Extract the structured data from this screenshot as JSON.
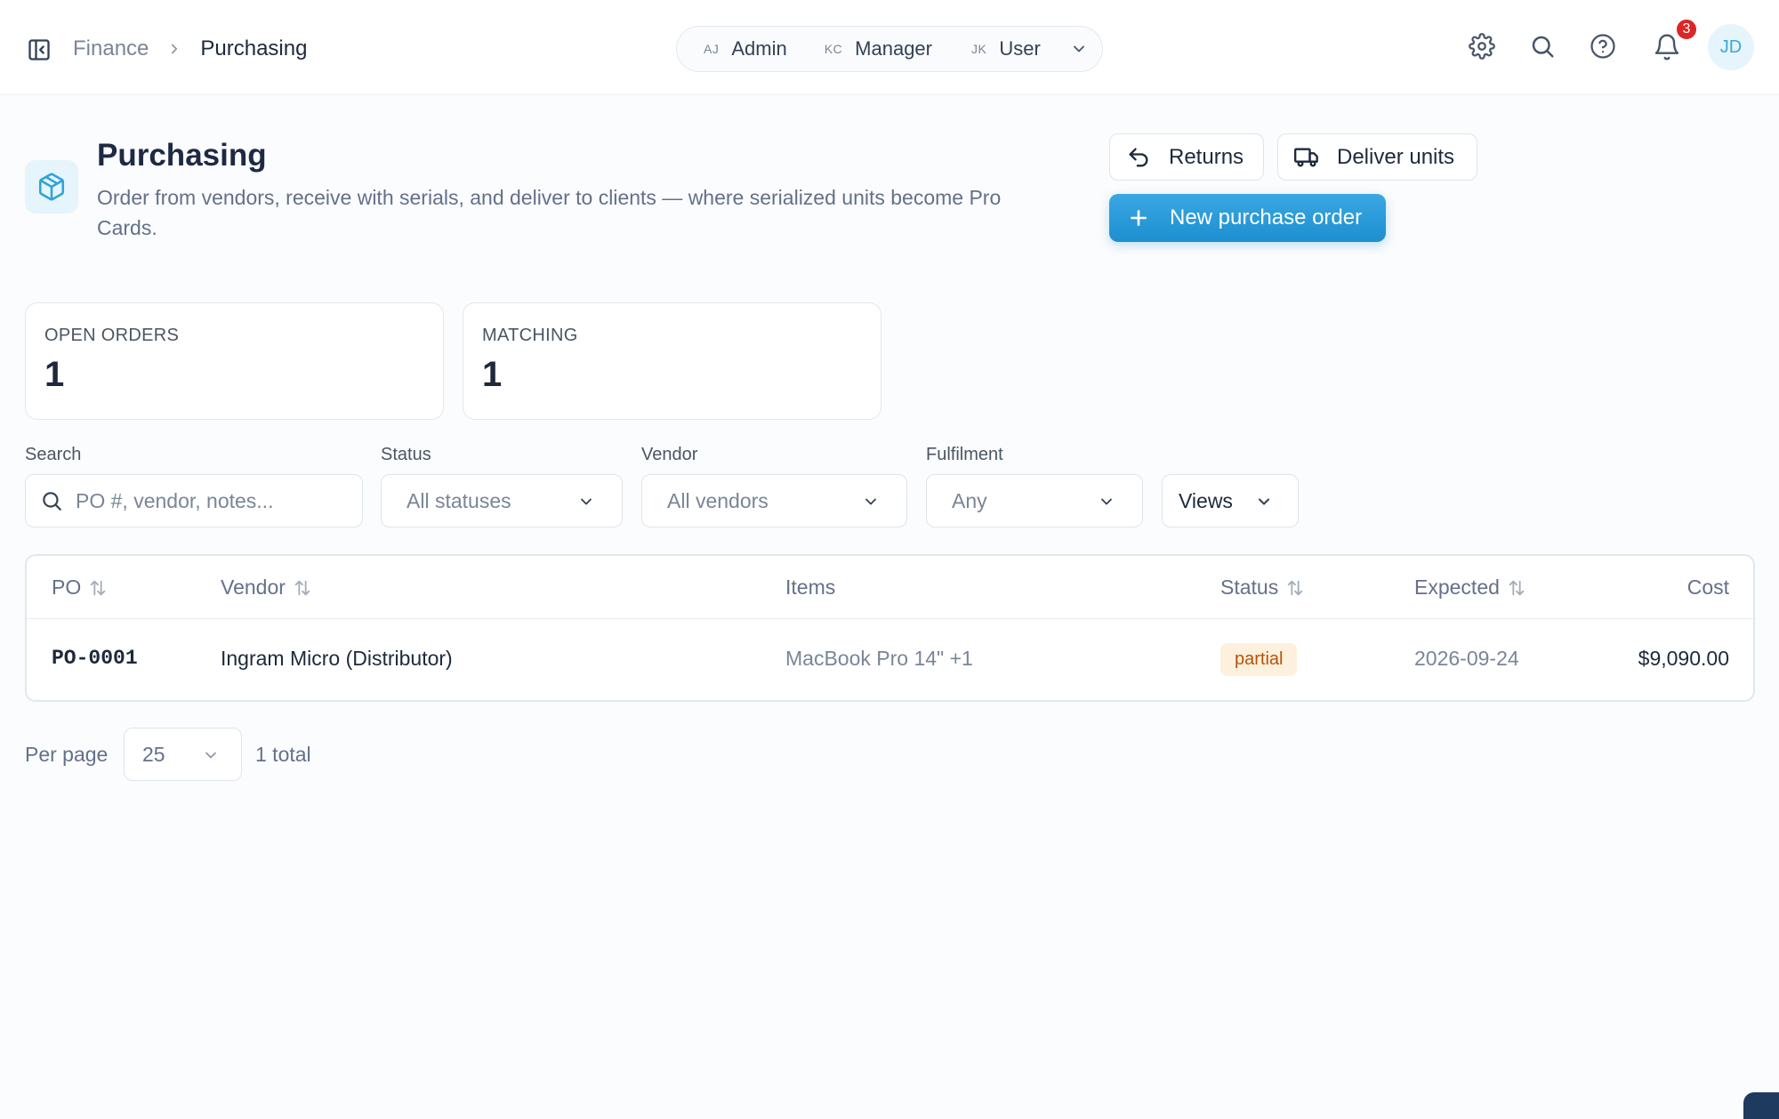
{
  "breadcrumb": {
    "parent": "Finance",
    "current": "Purchasing"
  },
  "role_switcher": {
    "roles": [
      {
        "initials": "AJ",
        "name": "Admin"
      },
      {
        "initials": "KC",
        "name": "Manager"
      },
      {
        "initials": "JK",
        "name": "User"
      }
    ]
  },
  "header_icons": [
    "settings-icon",
    "search-icon",
    "help-icon",
    "bell-icon"
  ],
  "notifications": {
    "count": "3"
  },
  "user": {
    "initials": "JD"
  },
  "page": {
    "title": "Purchasing",
    "description": "Order from vendors, receive with serials, and deliver to clients — where serialized units become Pro Cards.",
    "icon": "cube-icon"
  },
  "actions": {
    "returns": "Returns",
    "deliver_units": "Deliver units",
    "new_po": "New purchase order"
  },
  "stats": [
    {
      "label": "OPEN ORDERS",
      "value": "1"
    },
    {
      "label": "MATCHING",
      "value": "1"
    }
  ],
  "filters": {
    "search": {
      "label": "Search",
      "placeholder": "PO #, vendor, notes..."
    },
    "status": {
      "label": "Status",
      "value": "All statuses"
    },
    "vendor": {
      "label": "Vendor",
      "value": "All vendors"
    },
    "fulfilment": {
      "label": "Fulfilment",
      "value": "Any"
    },
    "views": {
      "value": "Views"
    }
  },
  "table": {
    "columns": [
      "PO",
      "Vendor",
      "Items",
      "Status",
      "Expected",
      "Cost"
    ],
    "rows": [
      {
        "po": "PO-0001",
        "vendor": "Ingram Micro (Distributor)",
        "items": "MacBook Pro 14\" +1",
        "status": "partial",
        "expected": "2026-09-24",
        "cost": "$9,090.00"
      }
    ]
  },
  "pagination": {
    "label": "Per page",
    "per_page": "25",
    "total": "1 total"
  },
  "colors": {
    "accent": "#1d8fd0",
    "badge_partial_bg": "#fdf0dc",
    "badge_partial_text": "#b45309",
    "notification": "#dc2626"
  }
}
